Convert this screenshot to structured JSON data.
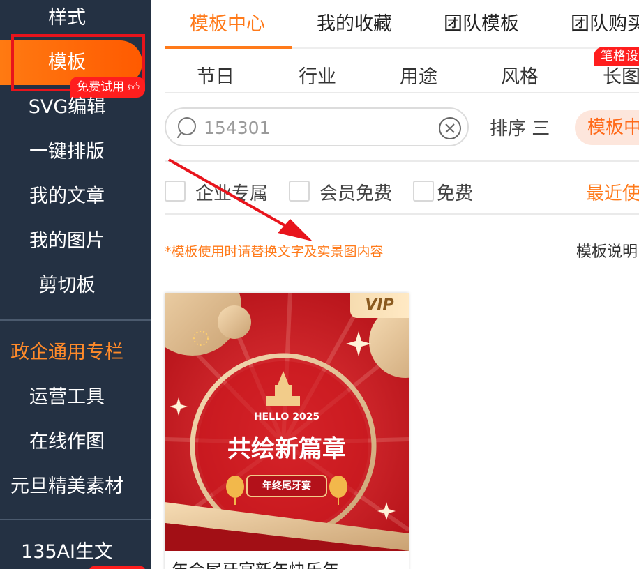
{
  "sidebar": {
    "items": [
      {
        "label": "样式"
      },
      {
        "label": "模板",
        "badge": "免费试用"
      },
      {
        "label": "SVG编辑"
      },
      {
        "label": "一键排版"
      },
      {
        "label": "我的文章"
      },
      {
        "label": "我的图片"
      },
      {
        "label": "剪切板"
      }
    ],
    "section_label": "政企通用专栏",
    "section_items": [
      {
        "label": "运营工具"
      },
      {
        "label": "在线作图"
      },
      {
        "label": "元旦精美素材"
      }
    ],
    "ai_item": "135AI生文"
  },
  "tabs": [
    {
      "label": "模板中心",
      "active": true
    },
    {
      "label": "我的收藏"
    },
    {
      "label": "团队模板"
    },
    {
      "label": "团队购买"
    }
  ],
  "subtabs": [
    {
      "label": "节日"
    },
    {
      "label": "行业"
    },
    {
      "label": "用途"
    },
    {
      "label": "风格"
    },
    {
      "label": "长图"
    }
  ],
  "hint_badge": "笔格设",
  "search": {
    "value": "154301"
  },
  "sort_label": "排序 三",
  "pill_label": "模板中",
  "filters": [
    {
      "label": "企业专属",
      "checked": false
    },
    {
      "label": "会员免费",
      "checked": false
    },
    {
      "label": "免费",
      "checked": false
    }
  ],
  "recent_label": "最近使",
  "note": "*模板使用时请替换文字及实景图内容",
  "help_label": "模板说明",
  "card": {
    "vip": "VIP",
    "hello": "HELLO 2025",
    "headline": "共绘新篇章",
    "ribbon": "年终尾牙宴",
    "title": "年会尾牙宴新年快乐年"
  },
  "colors": {
    "sidebar_bg": "#243143",
    "accent": "#ff7a1a",
    "alert_red": "#e8141c",
    "card_red": "#c4141a"
  }
}
